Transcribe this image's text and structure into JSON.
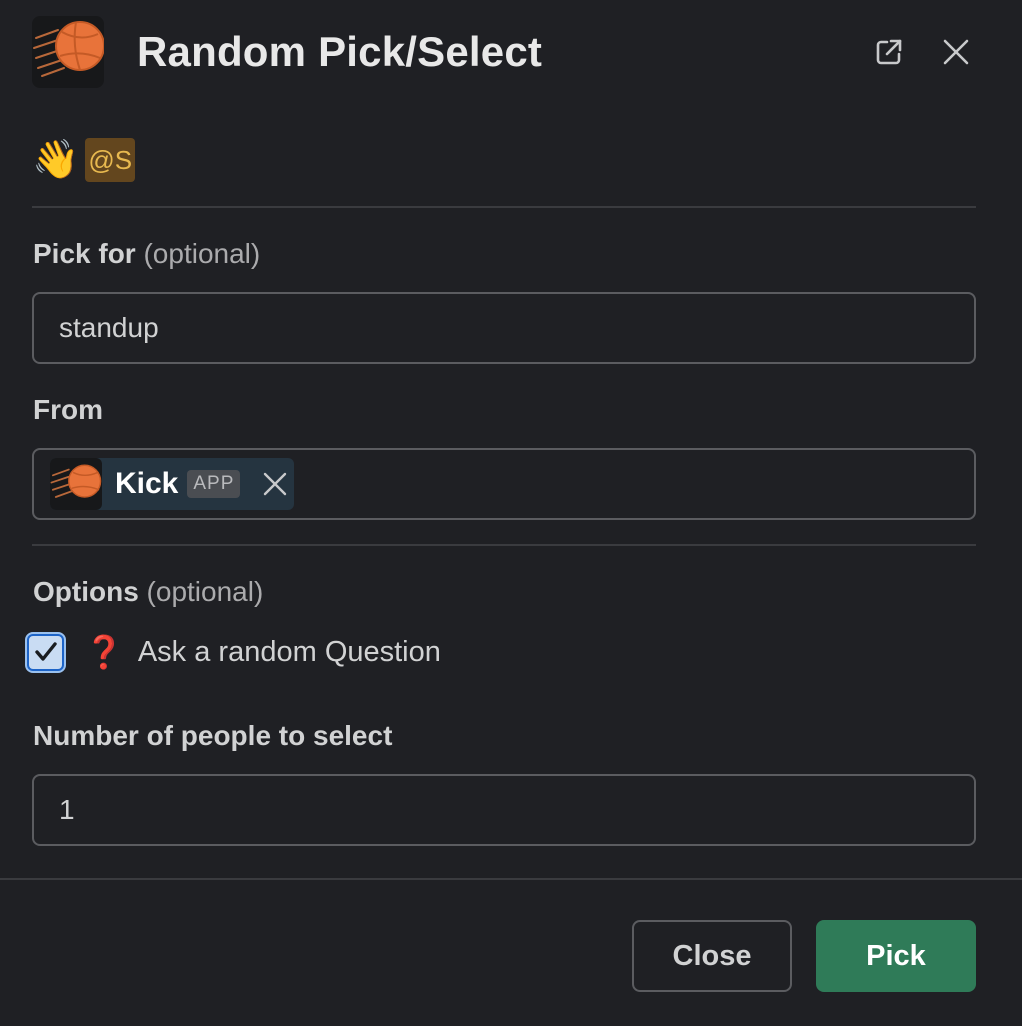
{
  "header": {
    "title": "Random Pick/Select",
    "app_icon": "basketball-icon",
    "popout_icon": "external-link-icon",
    "close_icon": "close-icon"
  },
  "greeting": {
    "emoji": "👋",
    "mention": "@S"
  },
  "pick_for": {
    "label": "Pick for",
    "optional": "(optional)",
    "value": "standup"
  },
  "from": {
    "label": "From",
    "selected": {
      "name": "Kick",
      "badge": "APP",
      "icon": "basketball-icon"
    }
  },
  "options": {
    "label": "Options",
    "optional": "(optional)",
    "checkbox": {
      "checked": true,
      "emoji": "❓",
      "text": "Ask a random Question"
    }
  },
  "number": {
    "label": "Number of people to select",
    "value": "1"
  },
  "footer": {
    "close_label": "Close",
    "pick_label": "Pick"
  },
  "colors": {
    "background": "#1f2024",
    "primary_button": "#2f7b58",
    "mention_bg": "#63461e",
    "mention_fg": "#e8b94f",
    "chip_bg": "#253440"
  }
}
